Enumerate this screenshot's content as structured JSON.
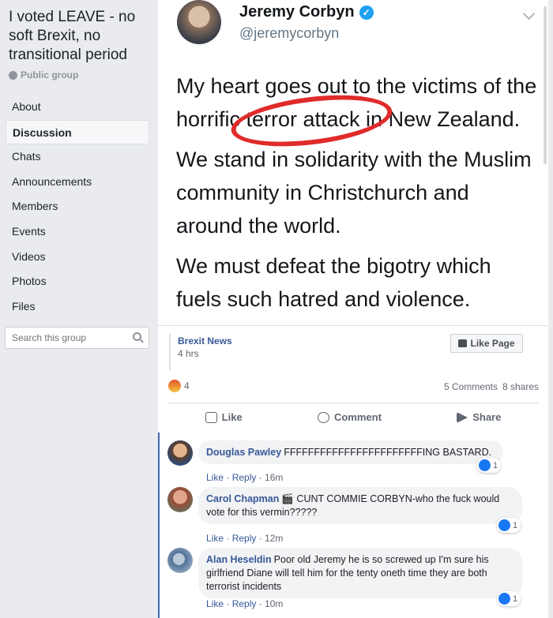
{
  "group": {
    "title": "I voted LEAVE - no soft Brexit, no transitional period",
    "privacy": "Public group"
  },
  "nav": {
    "items": [
      "About",
      "Discussion",
      "Chats",
      "Announcements",
      "Members",
      "Events",
      "Videos",
      "Photos",
      "Files"
    ],
    "active": "Discussion"
  },
  "search": {
    "placeholder": "Search this group"
  },
  "tweet": {
    "name": "Jeremy Corbyn",
    "handle": "@jeremycorbyn",
    "paragraphs": [
      "My heart goes out to the victims of the horrific terror attack in New Zealand.",
      "We stand in solidarity with the Muslim community in Christchurch and around the world.",
      "We must defeat the bigotry which fuels such hatred and violence."
    ]
  },
  "post": {
    "page_name": "Brexit News",
    "time": "4 hrs",
    "like_page": "Like Page",
    "reaction_count": "4",
    "comments": "5 Comments",
    "shares": "8 shares",
    "actions": {
      "like": "Like",
      "comment": "Comment",
      "share": "Share"
    }
  },
  "comments": [
    {
      "name": "Douglas Pawley",
      "text": "FFFFFFFFFFFFFFFFFFFFFFFING BASTARD.",
      "like": "Like",
      "reply": "Reply",
      "time": "16m",
      "reactions": "1"
    },
    {
      "name": "Carol Chapman",
      "text": "🎬 CUNT COMMIE CORBYN-who the fuck would vote for this vermin?????",
      "like": "Like",
      "reply": "Reply",
      "time": "12m",
      "reactions": "1"
    },
    {
      "name": "Alan Heseldin",
      "text": "Poor old Jeremy he is so screwed up I'm sure his girlfriend Diane will tell him for the tenty oneth time they are both terrorist incidents",
      "like": "Like",
      "reply": "Reply",
      "time": "10m",
      "reactions": "1"
    }
  ],
  "colors": {
    "link": "#385898",
    "annotation_circle": "#e02b2b",
    "verified": "#1da1f2"
  }
}
